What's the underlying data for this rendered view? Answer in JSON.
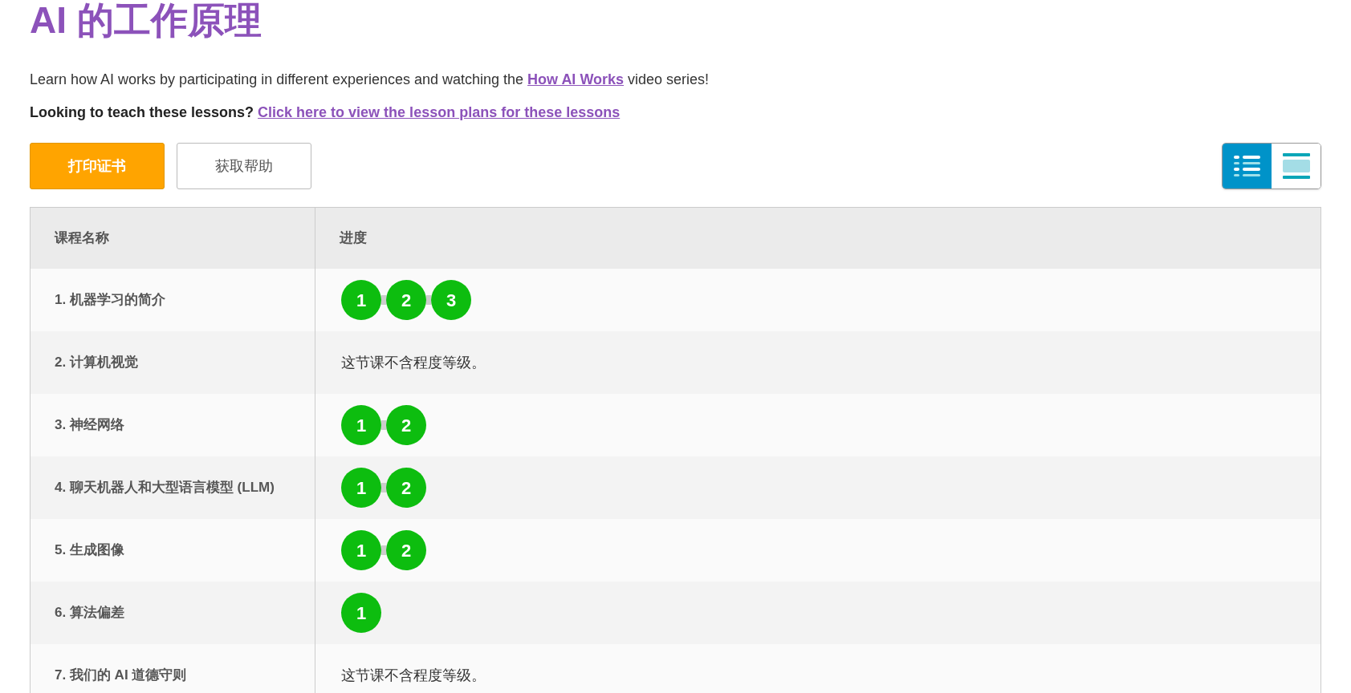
{
  "title": "AI 的工作原理",
  "intro": {
    "text": "Learn how AI works by participating in different experiences and watching the ",
    "link": "How AI Works",
    "after": " video series!"
  },
  "teach": {
    "text": "Looking to teach these lessons? ",
    "link": "Click here to view the lesson plans for these lessons"
  },
  "buttons": [
    {
      "label": "打印证书",
      "kind": "primary"
    },
    {
      "label": "获取帮助",
      "kind": "secondary"
    }
  ],
  "view_toggle": [
    {
      "kind": "list",
      "selected": true
    },
    {
      "kind": "detail",
      "selected": false
    }
  ],
  "table": {
    "columns": [
      "课程名称",
      "进度"
    ],
    "rows": [
      {
        "name": "1. 机器学习的简介",
        "levels": [
          "1",
          "2",
          "3"
        ]
      },
      {
        "name": "2. 计算机视觉",
        "note": "这节课不含程度等级。"
      },
      {
        "name": "3. 神经网络",
        "levels": [
          "1",
          "2"
        ]
      },
      {
        "name": "4. 聊天机器人和大型语言模型 (LLM)",
        "levels": [
          "1",
          "2"
        ]
      },
      {
        "name": "5. 生成图像",
        "levels": [
          "1",
          "2"
        ]
      },
      {
        "name": "6. 算法偏差",
        "levels": [
          "1"
        ]
      },
      {
        "name": "7. 我们的 AI 道德守则",
        "note": "这节课不含程度等级。"
      }
    ]
  }
}
